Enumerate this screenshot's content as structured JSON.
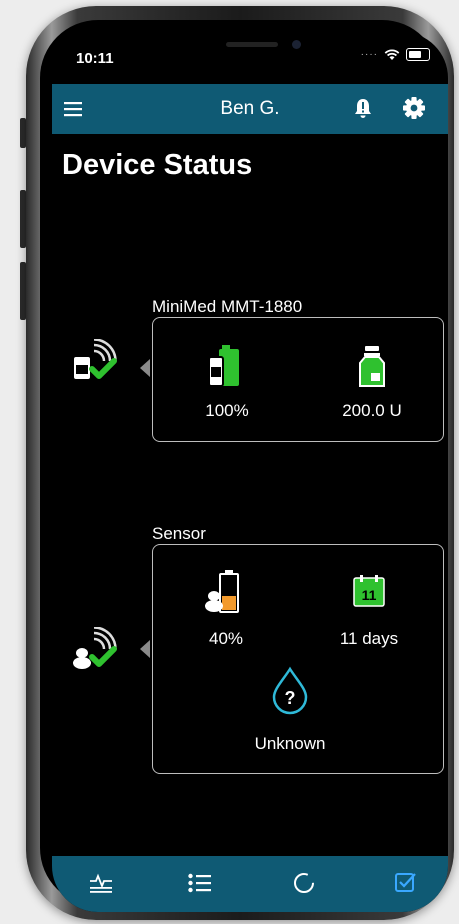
{
  "status_bar": {
    "time": "10:11"
  },
  "app_bar": {
    "title": "Ben G."
  },
  "page": {
    "title": "Device Status"
  },
  "pump": {
    "name": "MiniMed MMT-1880",
    "battery_label": "100%",
    "battery_level": 1.0,
    "reservoir_label": "200.0 U"
  },
  "sensor": {
    "name": "Sensor",
    "battery_label": "40%",
    "battery_level": 0.4,
    "calendar_day": "11",
    "life_label": "11 days",
    "status_label": "Unknown",
    "status_symbol": "?"
  },
  "bottom_nav": [
    "chart-icon",
    "list-icon",
    "refresh-icon",
    "checklist-icon"
  ],
  "colors": {
    "app_bar": "#0f5a74",
    "ok_green": "#2fc12f",
    "warn_orange": "#f39a2c",
    "drop_cyan": "#2fb9d8",
    "active_nav": "#3aa8ff"
  }
}
